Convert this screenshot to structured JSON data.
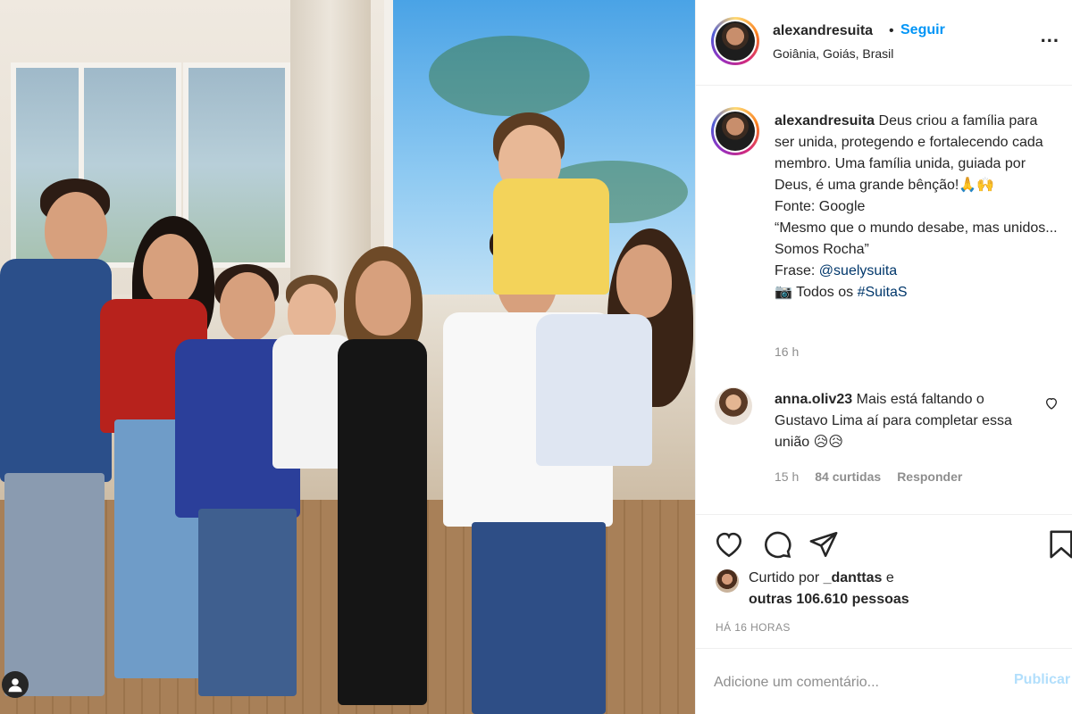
{
  "post": {
    "username": "alexandresuita",
    "follow_label": "Seguir",
    "separator": "•",
    "location": "Goiânia, Goiás, Brasil",
    "more_label": "..."
  },
  "caption": {
    "username": "alexandresuita",
    "line1": "Deus criou a família para ser unida, protegendo e fortalecendo cada membro. Uma família unida, guiada por Deus, é uma grande bênção!🙏🙌",
    "line2": "Fonte: Google",
    "line3": "“Mesmo que o mundo desabe, mas unidos... Somos Rocha”",
    "frase_prefix": "Frase: ",
    "frase_link": "@suelysuita",
    "todos_prefix": "📷 Todos os ",
    "todos_link": "#SuitaS",
    "time": "16 h"
  },
  "comment": {
    "username": "anna.oliv23",
    "text": "Mais está faltando o Gustavo Lima aí para completar essa união 😥😥",
    "time": "15 h",
    "likes": "84 curtidas",
    "reply": "Responder"
  },
  "likes": {
    "prefix": "Curtido por ",
    "user": "_danttas",
    "connector": " e",
    "others": "outras 106.610 pessoas"
  },
  "posted_ago": "HÁ 16 HORAS",
  "add_comment": {
    "placeholder": "Adicione um comentário...",
    "publish": "Publicar"
  },
  "icons": [
    "heart-icon",
    "comment-icon",
    "share-icon",
    "bookmark-icon",
    "more-icon",
    "user-icon"
  ],
  "colors": {
    "link_blue": "#0095f6",
    "link_dark": "#00376b",
    "muted": "#8e8e8e",
    "publish_disabled": "#b2dffc"
  }
}
